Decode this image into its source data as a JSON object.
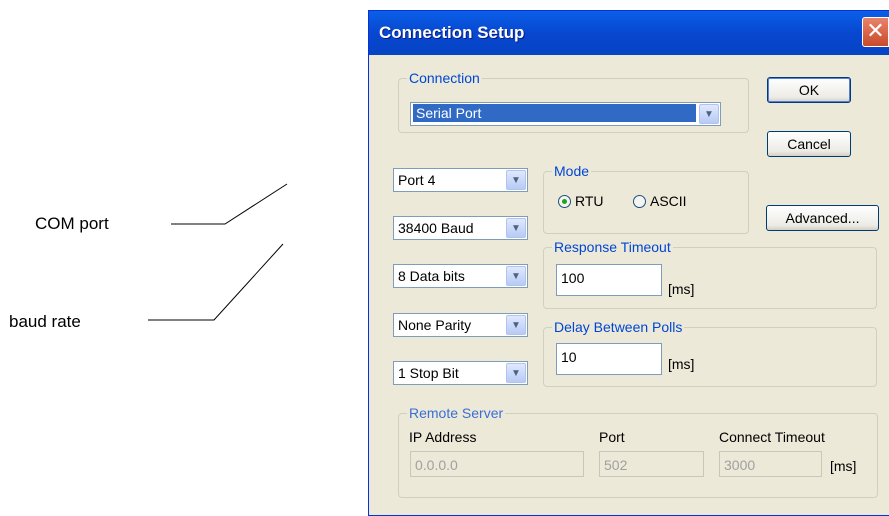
{
  "annotations": {
    "com_port": "COM port",
    "baud_rate": "baud rate"
  },
  "dialog": {
    "title": "Connection Setup",
    "close_glyph": "✕",
    "connection": {
      "legend": "Connection",
      "value": "Serial Port"
    },
    "buttons": {
      "ok": "OK",
      "cancel": "Cancel",
      "advanced": "Advanced..."
    },
    "serial": {
      "port": "Port 4",
      "baud": "38400 Baud",
      "data_bits": "8 Data bits",
      "parity": "None Parity",
      "stop_bits": "1 Stop Bit"
    },
    "mode": {
      "legend": "Mode",
      "rtu": "RTU",
      "ascii": "ASCII",
      "selected": "RTU"
    },
    "response_timeout": {
      "legend": "Response Timeout",
      "value": "100",
      "unit": "[ms]"
    },
    "delay_between_polls": {
      "legend": "Delay Between Polls",
      "value": "10",
      "unit": "[ms]"
    },
    "remote_server": {
      "legend": "Remote Server",
      "ip_label": "IP Address",
      "ip_value": "0.0.0.0",
      "port_label": "Port",
      "port_value": "502",
      "timeout_label": "Connect Timeout",
      "timeout_value": "3000",
      "timeout_unit": "[ms]"
    },
    "dropdown_arrow": "▼"
  }
}
